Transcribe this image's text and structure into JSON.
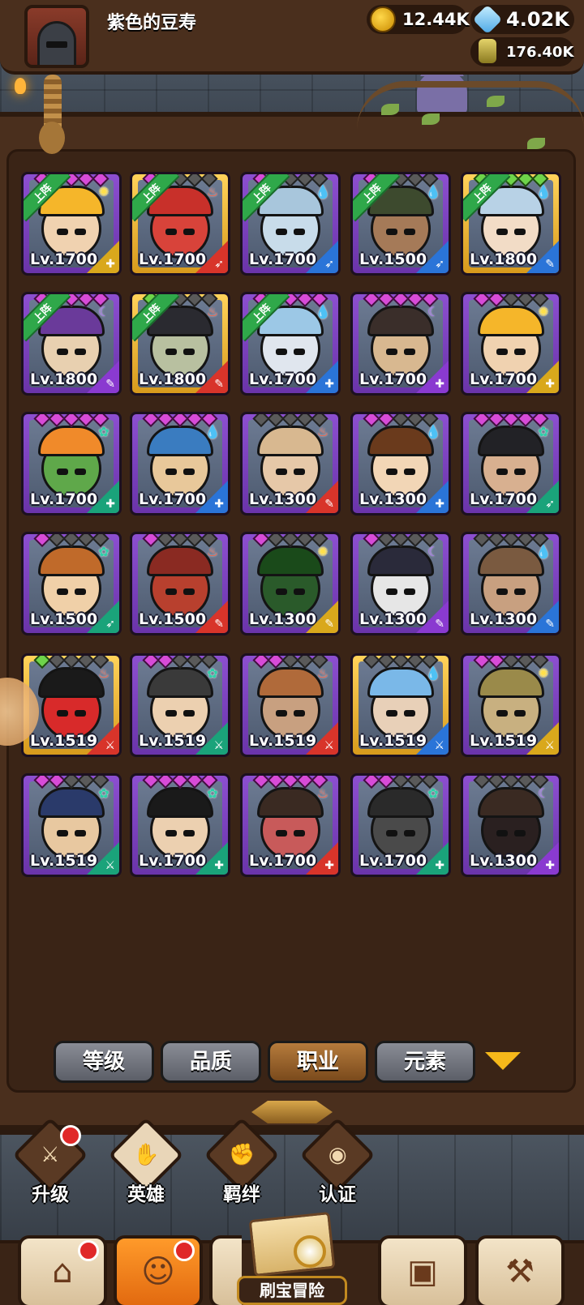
{
  "header": {
    "player_name": "紫色的豆寿",
    "gold": "12.44K",
    "gems": "4.02K",
    "elixir": "176.40K"
  },
  "deploy_label": "上阵",
  "heroes": [
    {
      "level": "Lv.1700",
      "frame": "purple",
      "stars": "ppppp",
      "element": "light",
      "elem_icon": "✺",
      "class_icon": "✚",
      "face": "#f0d2b0",
      "hat": "#f5b62a",
      "deployed": true
    },
    {
      "level": "Lv.1700",
      "frame": "gold",
      "stars": "ppddd",
      "element": "fire",
      "elem_icon": "♨",
      "class_icon": "➶",
      "face": "#d8433a",
      "hat": "#c8302a",
      "deployed": true
    },
    {
      "level": "Lv.1700",
      "frame": "purple",
      "stars": "ppddd",
      "element": "water",
      "elem_icon": "💧",
      "class_icon": "➶",
      "face": "#c8dcea",
      "hat": "#a8c6dc",
      "deployed": true
    },
    {
      "level": "Lv.1500",
      "frame": "purple",
      "stars": "pdddd",
      "element": "water",
      "elem_icon": "💧",
      "class_icon": "➶",
      "face": "#a57a58",
      "hat": "#3d4a2e",
      "deployed": true
    },
    {
      "level": "Lv.1800",
      "frame": "gold",
      "stars": "ggggg",
      "element": "water",
      "elem_icon": "💧",
      "class_icon": "✎",
      "face": "#f2dcc6",
      "hat": "#b8d2e6",
      "deployed": true
    },
    {
      "level": "Lv.1800",
      "frame": "purple",
      "stars": "ppppp",
      "element": "dark",
      "elem_icon": "☾",
      "class_icon": "✎",
      "face": "#e8d0b0",
      "hat": "#6a3a9a",
      "deployed": true
    },
    {
      "level": "Lv.1800",
      "frame": "gold",
      "stars": "gdddd",
      "element": "fire",
      "elem_icon": "♨",
      "class_icon": "✎",
      "face": "#b8c0a0",
      "hat": "#2a2a30",
      "deployed": true
    },
    {
      "level": "Lv.1700",
      "frame": "purple",
      "stars": "ppppp",
      "element": "water",
      "elem_icon": "💧",
      "class_icon": "✚",
      "face": "#e0e6ee",
      "hat": "#9cc8e6",
      "deployed": true
    },
    {
      "level": "Lv.1700",
      "frame": "purple",
      "stars": "ppppp",
      "element": "dark",
      "elem_icon": "☾",
      "class_icon": "✚",
      "face": "#d8b890",
      "hat": "#3a2e2a",
      "deployed": false
    },
    {
      "level": "Lv.1700",
      "frame": "purple",
      "stars": "ppddd",
      "element": "light",
      "elem_icon": "✺",
      "class_icon": "✚",
      "face": "#f0d2b0",
      "hat": "#f5b62a",
      "deployed": false
    },
    {
      "level": "Lv.1700",
      "frame": "purple",
      "stars": "ppppp",
      "element": "wind",
      "elem_icon": "✿",
      "class_icon": "✚",
      "face": "#5fa84a",
      "hat": "#f08a2a",
      "deployed": false
    },
    {
      "level": "Lv.1700",
      "frame": "purple",
      "stars": "ppppp",
      "element": "water",
      "elem_icon": "💧",
      "class_icon": "✚",
      "face": "#e8c89a",
      "hat": "#3a7cc0",
      "deployed": false
    },
    {
      "level": "Lv.1300",
      "frame": "purple",
      "stars": "ddddd",
      "element": "fire",
      "elem_icon": "♨",
      "class_icon": "✎",
      "face": "#e6c8a8",
      "hat": "#d8b890",
      "deployed": false
    },
    {
      "level": "Lv.1300",
      "frame": "purple",
      "stars": "ppddd",
      "element": "water",
      "elem_icon": "💧",
      "class_icon": "✚",
      "face": "#f2d6b6",
      "hat": "#6a3a1c",
      "deployed": false
    },
    {
      "level": "Lv.1700",
      "frame": "purple",
      "stars": "ppppp",
      "element": "wind",
      "elem_icon": "✿",
      "class_icon": "➶",
      "face": "#d8b090",
      "hat": "#222226",
      "deployed": false
    },
    {
      "level": "Lv.1500",
      "frame": "purple",
      "stars": "pdddd",
      "element": "wind",
      "elem_icon": "✿",
      "class_icon": "➶",
      "face": "#f0d0a8",
      "hat": "#c06a2a",
      "deployed": false
    },
    {
      "level": "Lv.1500",
      "frame": "purple",
      "stars": "pdddd",
      "element": "fire",
      "elem_icon": "♨",
      "class_icon": "✎",
      "face": "#b8402e",
      "hat": "#8a2a22",
      "deployed": false
    },
    {
      "level": "Lv.1300",
      "frame": "purple",
      "stars": "pdddd",
      "element": "light",
      "elem_icon": "✺",
      "class_icon": "✎",
      "face": "#2a5a2a",
      "hat": "#1a4a1a",
      "deployed": false
    },
    {
      "level": "Lv.1300",
      "frame": "purple",
      "stars": "pdddd",
      "element": "dark",
      "elem_icon": "☾",
      "class_icon": "✎",
      "face": "#e6e6e6",
      "hat": "#2a2a3a",
      "deployed": false
    },
    {
      "level": "Lv.1300",
      "frame": "purple",
      "stars": "ddddd",
      "element": "water",
      "elem_icon": "💧",
      "class_icon": "✎",
      "face": "#c8a080",
      "hat": "#7a5a40",
      "deployed": false
    },
    {
      "level": "Lv.1519",
      "frame": "gold",
      "stars": "gdddd",
      "element": "fire",
      "elem_icon": "♨",
      "class_icon": "⚔",
      "face": "#d82a2a",
      "hat": "#1a1a1a",
      "deployed": false
    },
    {
      "level": "Lv.1519",
      "frame": "purple",
      "stars": "ppddd",
      "element": "wind",
      "elem_icon": "✿",
      "class_icon": "⚔",
      "face": "#ecd0b0",
      "hat": "#3a3a3a",
      "deployed": false
    },
    {
      "level": "Lv.1519",
      "frame": "purple",
      "stars": "ppddd",
      "element": "fire",
      "elem_icon": "♨",
      "class_icon": "⚔",
      "face": "#c8a080",
      "hat": "#b06a3a",
      "deployed": false
    },
    {
      "level": "Lv.1519",
      "frame": "gold",
      "stars": "ddddd",
      "element": "water",
      "elem_icon": "💧",
      "class_icon": "⚔",
      "face": "#e8d0b8",
      "hat": "#7ab8e8",
      "deployed": false
    },
    {
      "level": "Lv.1519",
      "frame": "purple",
      "stars": "ppddd",
      "element": "light",
      "elem_icon": "✺",
      "class_icon": "⚔",
      "face": "#c8b080",
      "hat": "#9a8a4a",
      "deployed": false
    },
    {
      "level": "Lv.1519",
      "frame": "purple",
      "stars": "ppddd",
      "element": "wind",
      "elem_icon": "✿",
      "class_icon": "⚔",
      "face": "#e8c8a0",
      "hat": "#2a3a6a",
      "deployed": false
    },
    {
      "level": "Lv.1700",
      "frame": "purple",
      "stars": "ppppp",
      "element": "wind",
      "elem_icon": "✿",
      "class_icon": "✚",
      "face": "#ecd0b0",
      "hat": "#1a1a1a",
      "deployed": false
    },
    {
      "level": "Lv.1700",
      "frame": "purple",
      "stars": "ppppp",
      "element": "fire",
      "elem_icon": "♨",
      "class_icon": "✚",
      "face": "#c85a5a",
      "hat": "#3a2a22",
      "deployed": false
    },
    {
      "level": "Lv.1700",
      "frame": "purple",
      "stars": "ppddd",
      "element": "wind",
      "elem_icon": "✿",
      "class_icon": "✚",
      "face": "#4a4a4a",
      "hat": "#2a2a2a",
      "deployed": false
    },
    {
      "level": "Lv.1300",
      "frame": "purple",
      "stars": "ddddd",
      "element": "dark",
      "elem_icon": "☾",
      "class_icon": "✚",
      "face": "#2a2020",
      "hat": "#3a2a22",
      "deployed": false
    }
  ],
  "filters": {
    "level": "等级",
    "quality": "品质",
    "class": "职业",
    "element": "元素",
    "active": "class"
  },
  "subnav": {
    "upgrade": "升级",
    "heroes": "英雄",
    "bond": "羁绊",
    "certify": "认证",
    "active": "heroes"
  },
  "bottom": {
    "adventure": "刷宝冒险",
    "active_tab": "heroes"
  }
}
